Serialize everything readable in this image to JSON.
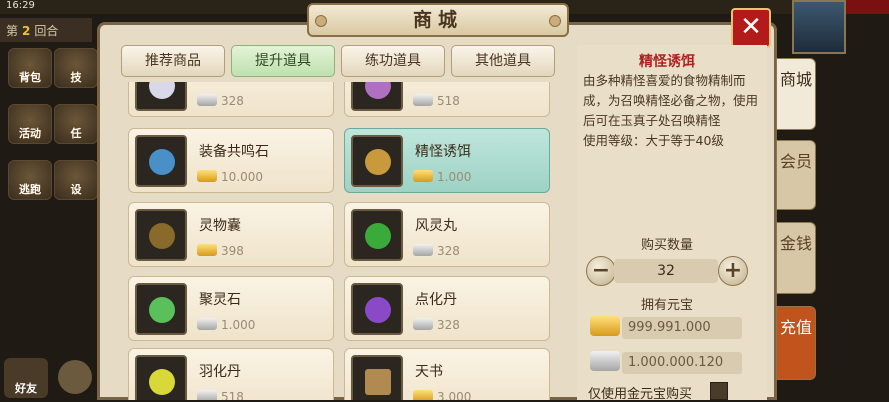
{
  "hud": {
    "time": "16:29",
    "round_prefix": "第",
    "round_number": "2",
    "round_suffix": "回合",
    "side_buttons": [
      "背包",
      "活动",
      "逃跑"
    ],
    "side_buttons_partial": [
      "技",
      "任",
      "设"
    ],
    "friend_label": "好友"
  },
  "shop": {
    "title": "商城",
    "close_icon": "close-icon",
    "tabs": [
      "推荐商品",
      "提升道具",
      "练功道具",
      "其他道具"
    ],
    "active_tab": "提升道具",
    "items": [
      {
        "name": "",
        "price": "328",
        "currency": "silver",
        "icon_color": "#d8d8e8"
      },
      {
        "name": "",
        "price": "518",
        "currency": "silver",
        "icon_color": "#b070c0"
      },
      {
        "name": "装备共鸣石",
        "price": "10.000",
        "currency": "gold",
        "icon_color": "#4a90c8"
      },
      {
        "name": "精怪诱饵",
        "price": "1.000",
        "currency": "gold",
        "icon_color": "#c89a3c"
      },
      {
        "name": "灵物囊",
        "price": "398",
        "currency": "gold",
        "icon_color": "#8a6a2a"
      },
      {
        "name": "风灵丸",
        "price": "328",
        "currency": "silver",
        "icon_color": "#3aaa3a"
      },
      {
        "name": "聚灵石",
        "price": "1.000",
        "currency": "silver",
        "icon_color": "#5ac05a"
      },
      {
        "name": "点化丹",
        "price": "328",
        "currency": "silver",
        "icon_color": "#8a4ac8"
      },
      {
        "name": "羽化丹",
        "price": "518",
        "currency": "silver",
        "icon_color": "#d8d838"
      },
      {
        "name": "天书",
        "price": "3.000",
        "currency": "gold",
        "icon_color": "#b08a50"
      }
    ],
    "detail": {
      "name": "精怪诱饵",
      "description": "由多种精怪喜爱的食物精制而成，为召唤精怪必备之物，使用后可在玉真子处召唤精怪",
      "level_req": "使用等级：大于等于40级",
      "qty_label": "购买数量",
      "qty_value": "32",
      "minus_label": "−",
      "plus_label": "+",
      "have_label": "拥有元宝",
      "gold_amount": "999.991.000",
      "silver_amount": "1.000.000.120",
      "only_gold_label": "仅使用金元宝购买"
    },
    "side_tabs": [
      "商城",
      "会员",
      "金钱",
      "充值"
    ]
  }
}
